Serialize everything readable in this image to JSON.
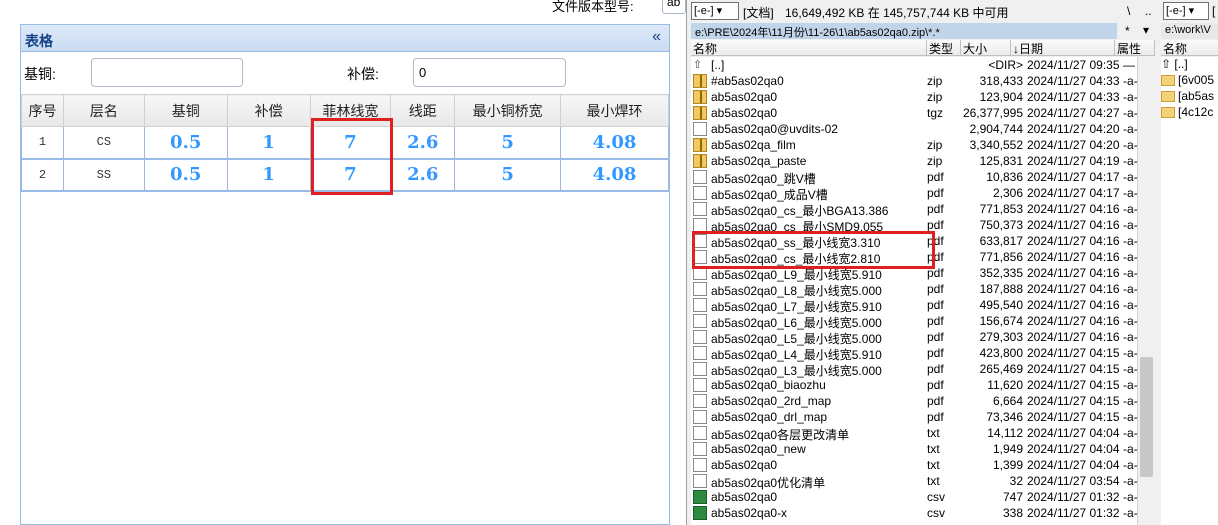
{
  "left": {
    "top_label": "文件版本型号:",
    "top_combo_value": "ab",
    "panel_title": "表格",
    "collapse_icon": "double-chevron-left-icon",
    "form": {
      "base_copper_label": "基铜:",
      "base_copper_value": "",
      "compensation_label": "补偿:",
      "compensation_value": "0"
    },
    "table": {
      "headers": [
        "序号",
        "层名",
        "基铜",
        "补偿",
        "菲林线宽",
        "线距",
        "最小铜桥宽",
        "最小焊环"
      ],
      "rows": [
        [
          "1",
          "CS",
          "0.5",
          "1",
          "7",
          "2.6",
          "5",
          "4.08"
        ],
        [
          "2",
          "SS",
          "0.5",
          "1",
          "7",
          "2.6",
          "5",
          "4.08"
        ]
      ]
    }
  },
  "fm": {
    "left_drive": "[-e-]",
    "left_drive_label": "[文档]",
    "left_free_text": "16,649,492 KB 在 145,757,744 KB 中可用",
    "left_root_btn": "\\",
    "left_up_btn": "..",
    "right_drive": "[-e-]",
    "right_drive_label": "[",
    "left_path": "e:\\PRE\\2024年\\11月份\\11-26\\1\\ab5as02qa0.zip\\*.*",
    "filter_star": "*",
    "filter_arrow": "▾",
    "right_path": "e:\\work\\V",
    "columns": {
      "name": "名称",
      "type": "类型",
      "size": "大小",
      "date": "↓日期",
      "attr": "属性"
    },
    "right_col_name": "名称",
    "files": [
      {
        "icon": "up",
        "name": "[..]",
        "type": "",
        "size": "<DIR>",
        "date": "2024/11/27 09:35",
        "attr": "—"
      },
      {
        "icon": "zip",
        "name": "#ab5as02qa0",
        "type": "zip",
        "size": "318,433",
        "date": "2024/11/27 04:33",
        "attr": "-a--"
      },
      {
        "icon": "zip",
        "name": "ab5as02qa0",
        "type": "zip",
        "size": "123,904",
        "date": "2024/11/27 04:33",
        "attr": "-a--"
      },
      {
        "icon": "zip",
        "name": "ab5as02qa0",
        "type": "tgz",
        "size": "26,377,995",
        "date": "2024/11/27 04:27",
        "attr": "-a--"
      },
      {
        "icon": "doc",
        "name": "ab5as02qa0@uvdits-02",
        "type": "",
        "size": "2,904,744",
        "date": "2024/11/27 04:20",
        "attr": "-a--"
      },
      {
        "icon": "zip",
        "name": "ab5as02qa_film",
        "type": "zip",
        "size": "3,340,552",
        "date": "2024/11/27 04:20",
        "attr": "-a--"
      },
      {
        "icon": "zip",
        "name": "ab5as02qa_paste",
        "type": "zip",
        "size": "125,831",
        "date": "2024/11/27 04:19",
        "attr": "-a--"
      },
      {
        "icon": "doc",
        "name": "ab5as02qa0_跳V槽",
        "type": "pdf",
        "size": "10,836",
        "date": "2024/11/27 04:17",
        "attr": "-a--"
      },
      {
        "icon": "doc",
        "name": "ab5as02qa0_成品V槽",
        "type": "pdf",
        "size": "2,306",
        "date": "2024/11/27 04:17",
        "attr": "-a--"
      },
      {
        "icon": "doc",
        "name": "ab5as02qa0_cs_最小BGA13.386",
        "type": "pdf",
        "size": "771,853",
        "date": "2024/11/27 04:16",
        "attr": "-a--"
      },
      {
        "icon": "doc",
        "name": "ab5as02qa0_cs_最小SMD9.055",
        "type": "pdf",
        "size": "750,373",
        "date": "2024/11/27 04:16",
        "attr": "-a--"
      },
      {
        "icon": "doc",
        "name": "ab5as02qa0_ss_最小线宽3.310",
        "type": "pdf",
        "size": "633,817",
        "date": "2024/11/27 04:16",
        "attr": "-a--"
      },
      {
        "icon": "doc",
        "name": "ab5as02qa0_cs_最小线宽2.810",
        "type": "pdf",
        "size": "771,856",
        "date": "2024/11/27 04:16",
        "attr": "-a--"
      },
      {
        "icon": "doc",
        "name": "ab5as02qa0_L9_最小线宽5.910",
        "type": "pdf",
        "size": "352,335",
        "date": "2024/11/27 04:16",
        "attr": "-a--"
      },
      {
        "icon": "doc",
        "name": "ab5as02qa0_L8_最小线宽5.000",
        "type": "pdf",
        "size": "187,888",
        "date": "2024/11/27 04:16",
        "attr": "-a--"
      },
      {
        "icon": "doc",
        "name": "ab5as02qa0_L7_最小线宽5.910",
        "type": "pdf",
        "size": "495,540",
        "date": "2024/11/27 04:16",
        "attr": "-a--"
      },
      {
        "icon": "doc",
        "name": "ab5as02qa0_L6_最小线宽5.000",
        "type": "pdf",
        "size": "156,674",
        "date": "2024/11/27 04:16",
        "attr": "-a--"
      },
      {
        "icon": "doc",
        "name": "ab5as02qa0_L5_最小线宽5.000",
        "type": "pdf",
        "size": "279,303",
        "date": "2024/11/27 04:16",
        "attr": "-a--"
      },
      {
        "icon": "doc",
        "name": "ab5as02qa0_L4_最小线宽5.910",
        "type": "pdf",
        "size": "423,800",
        "date": "2024/11/27 04:15",
        "attr": "-a--"
      },
      {
        "icon": "doc",
        "name": "ab5as02qa0_L3_最小线宽5.000",
        "type": "pdf",
        "size": "265,469",
        "date": "2024/11/27 04:15",
        "attr": "-a--"
      },
      {
        "icon": "doc",
        "name": "ab5as02qa0_biaozhu",
        "type": "pdf",
        "size": "11,620",
        "date": "2024/11/27 04:15",
        "attr": "-a--"
      },
      {
        "icon": "doc",
        "name": "ab5as02qa0_2rd_map",
        "type": "pdf",
        "size": "6,664",
        "date": "2024/11/27 04:15",
        "attr": "-a--"
      },
      {
        "icon": "doc",
        "name": "ab5as02qa0_drl_map",
        "type": "pdf",
        "size": "73,346",
        "date": "2024/11/27 04:15",
        "attr": "-a--"
      },
      {
        "icon": "doc",
        "name": "ab5as02qa0各层更改清单",
        "type": "txt",
        "size": "14,112",
        "date": "2024/11/27 04:04",
        "attr": "-a--"
      },
      {
        "icon": "doc",
        "name": "ab5as02qa0_new",
        "type": "txt",
        "size": "1,949",
        "date": "2024/11/27 04:04",
        "attr": "-a--"
      },
      {
        "icon": "doc",
        "name": "ab5as02qa0",
        "type": "txt",
        "size": "1,399",
        "date": "2024/11/27 04:04",
        "attr": "-a--"
      },
      {
        "icon": "doc",
        "name": "ab5as02qa0优化清单",
        "type": "txt",
        "size": "32",
        "date": "2024/11/27 03:54",
        "attr": "-a--"
      },
      {
        "icon": "csv",
        "name": "ab5as02qa0",
        "type": "csv",
        "size": "747",
        "date": "2024/11/27 01:32",
        "attr": "-a--"
      },
      {
        "icon": "csv",
        "name": "ab5as02qa0-x",
        "type": "csv",
        "size": "338",
        "date": "2024/11/27 01:32",
        "attr": "-a--"
      }
    ],
    "right_items": [
      "[..]",
      "[6v005",
      "[ab5as",
      "[4c12c"
    ]
  }
}
